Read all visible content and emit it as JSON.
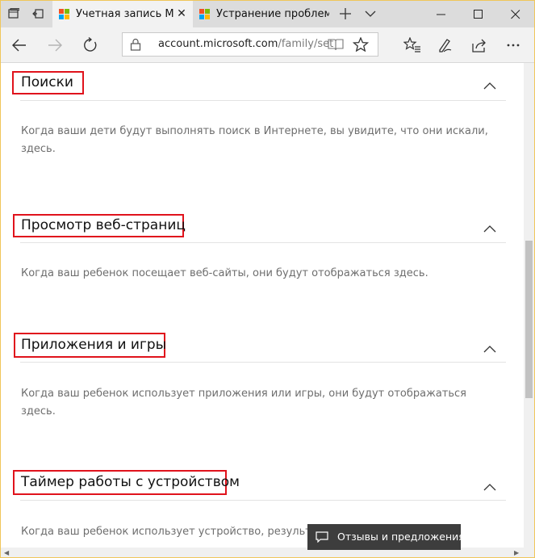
{
  "browser": {
    "tabs": [
      {
        "title": "Учетная запись Ma",
        "active": true
      },
      {
        "title": "Устранение проблемь",
        "active": false
      }
    ],
    "address": {
      "url_domain": "account.microsoft.com",
      "url_path": "/family/set"
    },
    "icons": [
      "tab-list-icon",
      "set-aside-tabs-icon",
      "microsoft-logo-icon",
      "new-tab-icon",
      "tab-preview-chevron-icon",
      "back-icon",
      "forward-icon",
      "refresh-icon",
      "lock-icon",
      "reading-view-icon",
      "favorite-star-icon",
      "favorites-hub-icon",
      "web-note-icon",
      "share-icon",
      "more-icon",
      "minimize-icon",
      "maximize-icon",
      "close-icon"
    ]
  },
  "colors": {
    "highlight_box": "#e0131c",
    "ms_red": "#f25022",
    "ms_green": "#7fba00",
    "ms_blue": "#00a4ef",
    "ms_yellow": "#ffb900"
  },
  "sections": [
    {
      "title": "Поиски",
      "description": "Когда ваши дети будут выполнять поиск в Интернете, вы увидите, что они искали, здесь."
    },
    {
      "title": "Просмотр веб-страниц",
      "description": "Когда ваш ребенок посещает веб-сайты, они будут отображаться здесь."
    },
    {
      "title": "Приложения и игры",
      "description": "Когда ваш ребенок использует приложения или игры, они будут отображаться здесь."
    },
    {
      "title": "Таймер работы с устройством",
      "description": "Когда ваш ребенок использует устройство, результ"
    }
  ],
  "feedback": {
    "label": "Отзывы и предложения"
  }
}
